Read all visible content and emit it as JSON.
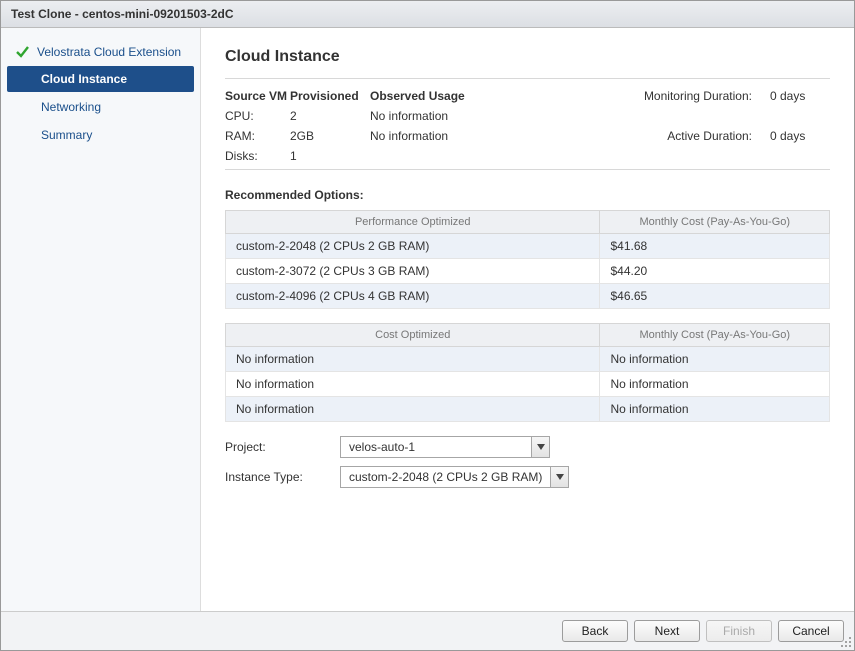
{
  "window": {
    "title": "Test Clone - centos-mini-09201503-2dC"
  },
  "sidebar": {
    "top": {
      "label": "Velostrata Cloud Extension",
      "done": true
    },
    "items": [
      {
        "label": "Cloud Instance",
        "active": true
      },
      {
        "label": "Networking",
        "active": false
      },
      {
        "label": "Summary",
        "active": false
      }
    ]
  },
  "page": {
    "title": "Cloud Instance",
    "source_header": {
      "vm": "Source VM",
      "prov": "Provisioned",
      "obs": "Observed Usage"
    },
    "source_rows": [
      {
        "label": "CPU:",
        "prov": "2",
        "obs": "No information"
      },
      {
        "label": "RAM:",
        "prov": "2GB",
        "obs": "No information"
      },
      {
        "label": "Disks:",
        "prov": "1",
        "obs": ""
      }
    ],
    "monitoring_label": "Monitoring Duration:",
    "monitoring_value": "0 days",
    "active_label": "Active Duration:",
    "active_value": "0 days",
    "rec_label": "Recommended Options:",
    "perf_header": "Performance Optimized",
    "cost_header_perf": "Monthly Cost (Pay-As-You-Go)",
    "perf_rows": [
      {
        "name": "custom-2-2048 (2 CPUs 2 GB RAM)",
        "cost": "$41.68"
      },
      {
        "name": "custom-2-3072 (2 CPUs 3 GB RAM)",
        "cost": "$44.20"
      },
      {
        "name": "custom-2-4096 (2 CPUs 4 GB RAM)",
        "cost": "$46.65"
      }
    ],
    "costopt_header": "Cost Optimized",
    "cost_header_cost": "Monthly Cost (Pay-As-You-Go)",
    "cost_rows": [
      {
        "name": "No information",
        "cost": "No information"
      },
      {
        "name": "No information",
        "cost": "No information"
      },
      {
        "name": "No information",
        "cost": "No information"
      }
    ],
    "project_label": "Project:",
    "project_value": "velos-auto-1",
    "instance_type_label": "Instance Type:",
    "instance_type_value": "custom-2-2048 (2 CPUs 2 GB RAM)"
  },
  "footer": {
    "back": "Back",
    "next": "Next",
    "finish": "Finish",
    "cancel": "Cancel"
  }
}
